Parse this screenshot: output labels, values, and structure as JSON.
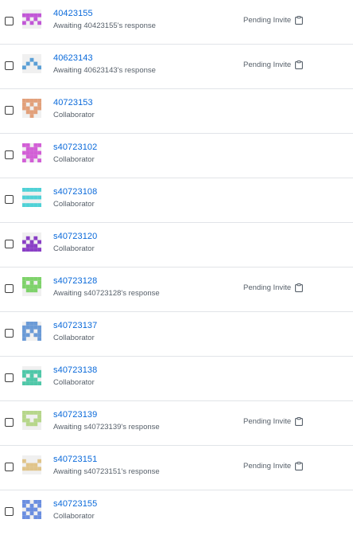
{
  "rows": [
    {
      "username": "40423155",
      "status": "Awaiting 40423155's response",
      "pending": "Pending Invite",
      "avatar_color": "#c157d6",
      "avatar_pattern": "00000.11111.01010.10101.00000"
    },
    {
      "username": "40623143",
      "status": "Awaiting 40623143's response",
      "pending": "Pending Invite",
      "avatar_color": "#5a9fd6",
      "avatar_pattern": "00000.00100.01010.10001.00000"
    },
    {
      "username": "40723153",
      "status": "Collaborator",
      "pending": "",
      "avatar_color": "#e2a07a",
      "avatar_pattern": "11111.10101.11011.01110.00100"
    },
    {
      "username": "s40723102",
      "status": "Collaborator",
      "pending": "",
      "avatar_color": "#d25fd6",
      "avatar_pattern": "11011.01110.11111.01110.10101"
    },
    {
      "username": "s40723108",
      "status": "Collaborator",
      "pending": "",
      "avatar_color": "#4fd1d6",
      "avatar_pattern": "11111.00000.11111.00000.11111"
    },
    {
      "username": "s40723120",
      "status": "Collaborator",
      "pending": "",
      "avatar_color": "#8a3fc6",
      "avatar_pattern": "00000.01010.10101.01110.11111"
    },
    {
      "username": "s40723128",
      "status": "Awaiting s40723128's response",
      "pending": "Pending Invite",
      "avatar_color": "#7ed26a",
      "avatar_pattern": "11111.10101.11111.01110.00000"
    },
    {
      "username": "s40723137",
      "status": "Collaborator",
      "pending": "",
      "avatar_color": "#6a9ad6",
      "avatar_pattern": "01110.11111.10101.11011.10001"
    },
    {
      "username": "s40723138",
      "status": "Collaborator",
      "pending": "",
      "avatar_color": "#4fc7a8",
      "avatar_pattern": "00000.11111.10101.01110.11111"
    },
    {
      "username": "s40723139",
      "status": "Awaiting s40723139's response",
      "pending": "Pending Invite",
      "avatar_color": "#b6d68a",
      "avatar_pattern": "11111.10001.11011.01110.00000"
    },
    {
      "username": "s40723151",
      "status": "Awaiting s40723151's response",
      "pending": "Pending Invite",
      "avatar_color": "#e0c48a",
      "avatar_pattern": "00000.10001.01110.11111.00000"
    },
    {
      "username": "s40723155",
      "status": "Collaborator",
      "pending": "",
      "avatar_color": "#6a8ee0",
      "avatar_pattern": "11011.10101.01110.10101.11011"
    }
  ],
  "icons": {
    "checkbox": "checkbox-icon",
    "copy": "clipboard-icon"
  }
}
